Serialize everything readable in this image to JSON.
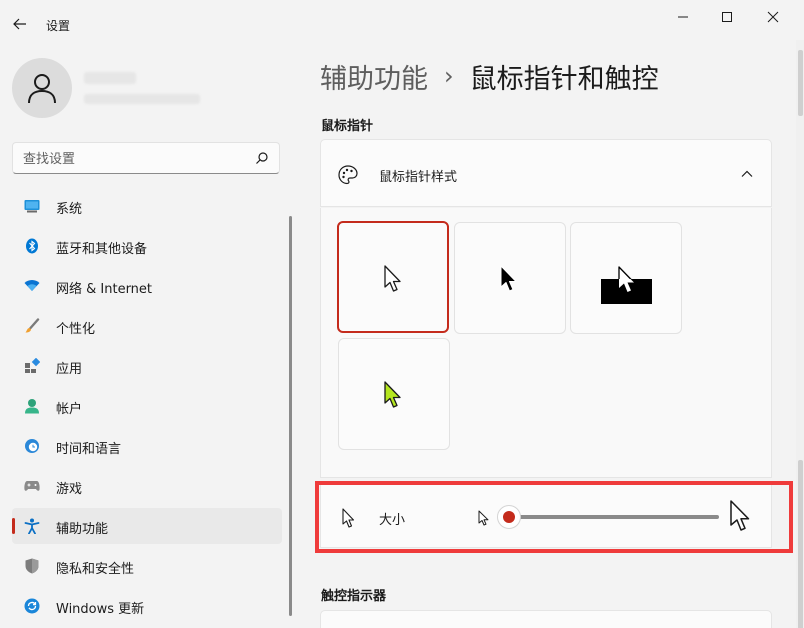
{
  "window": {
    "title": "设置"
  },
  "search": {
    "placeholder": "查找设置"
  },
  "nav": {
    "items": [
      {
        "label": "系统"
      },
      {
        "label": "蓝牙和其他设备"
      },
      {
        "label": "网络 & Internet"
      },
      {
        "label": "个性化"
      },
      {
        "label": "应用"
      },
      {
        "label": "帐户"
      },
      {
        "label": "时间和语言"
      },
      {
        "label": "游戏"
      },
      {
        "label": "辅助功能"
      },
      {
        "label": "隐私和安全性"
      },
      {
        "label": "Windows 更新"
      }
    ],
    "active_index": 8
  },
  "breadcrumb": {
    "parent": "辅助功能",
    "separator": "›",
    "current": "鼠标指针和触控"
  },
  "sections": {
    "pointer_title": "鼠标指针",
    "touch_title": "触控指示器"
  },
  "pointer_style": {
    "label": "鼠标指针样式",
    "expanded": true,
    "options": [
      "white",
      "black",
      "inverted",
      "custom"
    ],
    "selected": "white",
    "custom_color": "#b4e61e"
  },
  "size": {
    "label": "大小",
    "level": 0.0
  },
  "colors": {
    "accent": "#c42b1c",
    "highlight_box": "#ef3b3b"
  }
}
